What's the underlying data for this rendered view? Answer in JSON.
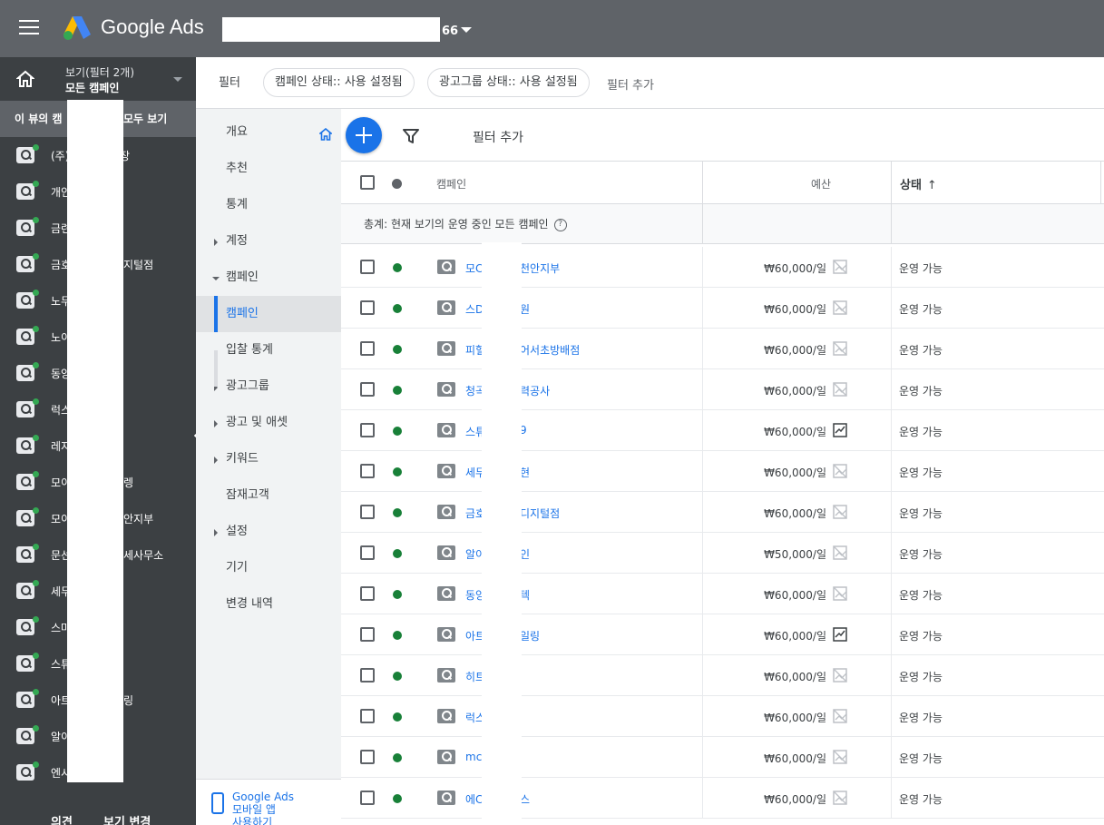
{
  "app": {
    "title": "Google Ads",
    "account_suffix": "66"
  },
  "leftnav": {
    "view_line1": "보기(필터 2개)",
    "view_line2": "모든 캠페인",
    "see_all_left": "이 뷰의 캠",
    "see_all_right": "모두 보기",
    "campaigns": [
      {
        "a": "(주)",
        "b": "포장",
        "bx": 121
      },
      {
        "a": "개인",
        "b": "",
        "bx": 0
      },
      {
        "a": "금련",
        "b": "",
        "bx": 0
      },
      {
        "a": "금호",
        "b": "지털점",
        "bx": 136
      },
      {
        "a": "노무",
        "b": "",
        "bx": 0
      },
      {
        "a": "노이",
        "b": "",
        "bx": 0
      },
      {
        "a": "동양",
        "b": "",
        "bx": 0
      },
      {
        "a": "럭스",
        "b": "",
        "bx": 0
      },
      {
        "a": "레지",
        "b": "",
        "bx": 0
      },
      {
        "a": "모이",
        "b": "렝",
        "bx": 136
      },
      {
        "a": "모이",
        "b": "안지부",
        "bx": 136
      },
      {
        "a": "문선",
        "b": "세사무소",
        "bx": 136
      },
      {
        "a": "세무",
        "b": "",
        "bx": 0
      },
      {
        "a": "스마",
        "b": "",
        "bx": 0
      },
      {
        "a": "스튜",
        "b": "",
        "bx": 0
      },
      {
        "a": "아트",
        "b": "링",
        "bx": 136
      },
      {
        "a": "알이",
        "b": "",
        "bx": 0
      },
      {
        "a": "엔시",
        "b": "",
        "bx": 0
      }
    ],
    "bottom_left": "의견",
    "bottom_right": "보기 변경"
  },
  "filterbar": {
    "label": "필터",
    "chips": [
      "캠페인 상태:: 사용 설정됨",
      "광고그룹 상태:: 사용 설정됨"
    ],
    "add_filter": "필터 추가"
  },
  "subnav": {
    "items": [
      {
        "label": "개요",
        "arrow": ""
      },
      {
        "label": "추천",
        "arrow": ""
      },
      {
        "label": "통계",
        "arrow": ""
      },
      {
        "label": "계정",
        "arrow": "right"
      },
      {
        "label": "캠페인",
        "arrow": "down"
      },
      {
        "label": "캠페인",
        "arrow": "",
        "active": true
      },
      {
        "label": "입찰 통계",
        "arrow": ""
      },
      {
        "label": "광고그룹",
        "arrow": "right"
      },
      {
        "label": "광고 및 애셋",
        "arrow": "right"
      },
      {
        "label": "키워드",
        "arrow": "right"
      },
      {
        "label": "잠재고객",
        "arrow": ""
      },
      {
        "label": "설정",
        "arrow": "right"
      },
      {
        "label": "기기",
        "arrow": ""
      },
      {
        "label": "변경 내역",
        "arrow": ""
      }
    ],
    "promo_line1": "Google Ads",
    "promo_line2": "모바일 앱",
    "promo_line3": "사용하기"
  },
  "table": {
    "add_filter": "필터 추가",
    "headers": {
      "campaign": "캠페인",
      "budget": "예산",
      "status": "상태",
      "status_sort": "↑"
    },
    "totals_label": "총계: 현재 보기의 운영 중인 모든 캠페인",
    "rows": [
      {
        "n1": "모C",
        "n2": "천안지부",
        "budget": "₩60,000/일",
        "icon": "none",
        "status": "운영 가능"
      },
      {
        "n1": "스D",
        "n2": "원",
        "budget": "₩60,000/일",
        "icon": "none",
        "status": "운영 가능"
      },
      {
        "n1": "피헐",
        "n2": "어서초방배점",
        "budget": "₩60,000/일",
        "icon": "none",
        "status": "운영 가능"
      },
      {
        "n1": "청곡",
        "n2": "력공사",
        "budget": "₩60,000/일",
        "icon": "none",
        "status": "운영 가능"
      },
      {
        "n1": "스튜",
        "n2": "9",
        "budget": "₩60,000/일",
        "icon": "trend",
        "status": "운영 가능"
      },
      {
        "n1": "세무",
        "n2": "현",
        "budget": "₩60,000/일",
        "icon": "none",
        "status": "운영 가능"
      },
      {
        "n1": "금호",
        "n2": "디지털점",
        "budget": "₩60,000/일",
        "icon": "none",
        "status": "운영 가능"
      },
      {
        "n1": "알이",
        "n2": "인",
        "budget": "₩50,000/일",
        "icon": "none",
        "status": "운영 가능"
      },
      {
        "n1": "동양",
        "n2": "텍",
        "budget": "₩60,000/일",
        "icon": "none",
        "status": "운영 가능"
      },
      {
        "n1": "아트",
        "n2": "일링",
        "budget": "₩60,000/일",
        "icon": "trend",
        "status": "운영 가능"
      },
      {
        "n1": "히트",
        "n2": "",
        "budget": "₩60,000/일",
        "icon": "none",
        "status": "운영 가능"
      },
      {
        "n1": "럭스",
        "n2": "",
        "budget": "₩60,000/일",
        "icon": "none",
        "status": "운영 가능"
      },
      {
        "n1": "mc",
        "n2": "",
        "budget": "₩60,000/일",
        "icon": "none",
        "status": "운영 가능"
      },
      {
        "n1": "에C",
        "n2": "스",
        "budget": "₩60,000/일",
        "icon": "none",
        "status": "운영 가능"
      }
    ]
  },
  "colors": {
    "topbar": "#5f6368",
    "leftnav": "#3c4043",
    "accent": "#1a73e8",
    "status_green": "#188038"
  }
}
